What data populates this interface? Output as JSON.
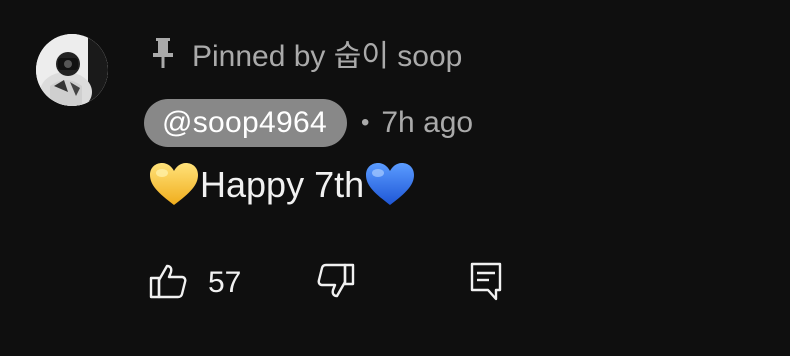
{
  "comment": {
    "pinned_text": "Pinned by 숩이 soop",
    "author_handle": "@soop4964",
    "separator": "•",
    "timestamp": "7h ago",
    "body_text": "Happy 7th",
    "leading_emoji": "yellow-heart",
    "trailing_emoji": "blue-heart",
    "like_count": "57"
  },
  "icons": {
    "pin": "pin-icon",
    "like": "thumbs-up-icon",
    "dislike": "thumbs-down-icon",
    "reply": "reply-icon"
  },
  "colors": {
    "background": "#0f0f0f",
    "primary_text": "#f1f1f1",
    "secondary_text": "#aaaaaa",
    "author_chip": "#888888",
    "yellow_heart": "#f8c640",
    "blue_heart": "#2f6fe8"
  }
}
